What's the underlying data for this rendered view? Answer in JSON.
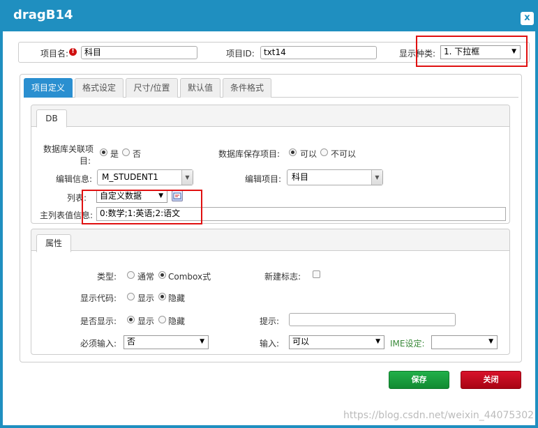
{
  "window": {
    "title": "dragB14",
    "close_label": "x"
  },
  "top": {
    "item_name_label": "项目名:",
    "item_name_value": "科目",
    "item_id_label": "项目ID:",
    "item_id_value": "txt14",
    "display_type_label": "显示种类:",
    "display_type_value": "1. 下拉框"
  },
  "tabs": [
    {
      "label": "项目定义"
    },
    {
      "label": "格式设定"
    },
    {
      "label": "尺寸/位置"
    },
    {
      "label": "默认值"
    },
    {
      "label": "条件格式"
    }
  ],
  "db": {
    "tab_label": "DB",
    "db_link_label_1": "数据库关联项",
    "db_link_label_2": "目:",
    "db_link_yes": "是",
    "db_link_no": "否",
    "db_save_label": "数据库保存项目:",
    "db_save_yes": "可以",
    "db_save_no": "不可以",
    "edit_info_label": "编辑信息:",
    "edit_info_value": "M_STUDENT1",
    "edit_item_label": "编辑项目:",
    "edit_item_value": "科目",
    "list_label": "列表:",
    "list_value": "自定义数据",
    "main_list_label": "主列表值信息:",
    "main_list_value": "0:数学;1:英语;2:语文"
  },
  "props": {
    "tab_label": "属性",
    "type_label": "类型:",
    "type_normal": "通常",
    "type_combox": "Combox式",
    "new_flag_label": "新建标志:",
    "show_code_label": "显示代码:",
    "show_code_show": "显示",
    "show_code_hide": "隐藏",
    "visible_label": "是否显示:",
    "visible_show": "显示",
    "visible_hide": "隐藏",
    "hint_label": "提示:",
    "required_label": "必须输入:",
    "required_value": "否",
    "input_label": "输入:",
    "input_value": "可以",
    "ime_label": "IME设定:",
    "ime_value": ""
  },
  "buttons": {
    "save": "保存",
    "close": "关闭"
  },
  "watermark": "https://blog.csdn.net/weixin_44075302",
  "colors": {
    "accent": "#1f8fc0",
    "tab_active": "#2a8fd0",
    "save": "#16a34a",
    "close": "#c0081a",
    "highlight": "#e01010",
    "ime_label": "#3a8a3a"
  }
}
